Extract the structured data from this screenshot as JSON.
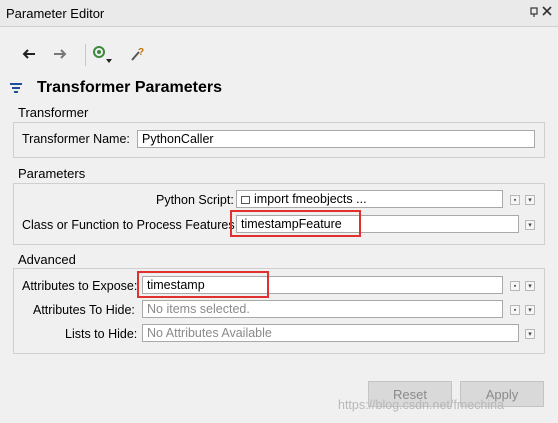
{
  "window": {
    "title": "Parameter Editor",
    "title_icons": "ᴘ ×"
  },
  "header": {
    "title": "Transformer Parameters"
  },
  "groups": {
    "transformer": {
      "label": "Transformer",
      "name_label": "Transformer Name:",
      "name_value": "PythonCaller"
    },
    "parameters": {
      "label": "Parameters",
      "script_label": "Python Script:",
      "script_value": "import fmeobjects ...",
      "class_label": "Class or Function to Process Features",
      "class_value": "timestampFeature"
    },
    "advanced": {
      "label": "Advanced",
      "expose_label": "Attributes to Expose:",
      "expose_value": "timestamp",
      "hide_label": "Attributes To Hide:",
      "hide_placeholder": "No items selected.",
      "lists_label": "Lists to Hide:",
      "lists_placeholder": "No Attributes Available"
    }
  },
  "footer": {
    "reset_label": "Reset",
    "apply_label": "Apply"
  },
  "watermark": "https://blog.csdn.net/fmechina",
  "colors": {
    "highlight": "#e03030",
    "heading_icon": "#1f4e9c"
  }
}
